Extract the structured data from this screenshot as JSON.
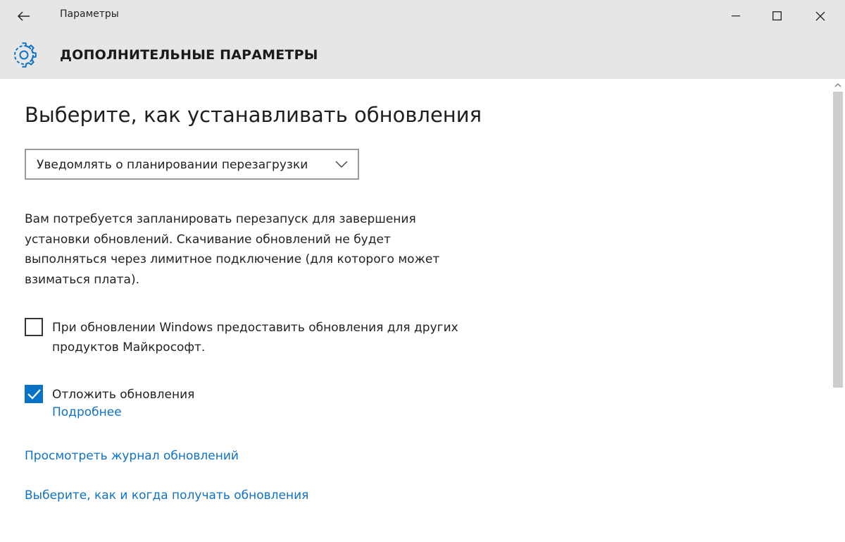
{
  "window": {
    "title": "Параметры",
    "back_icon": "arrow-left-icon",
    "minimize_icon": "minimize-icon",
    "maximize_icon": "maximize-icon",
    "close_icon": "close-icon"
  },
  "header": {
    "icon": "gear-icon",
    "title": "ДОПОЛНИТЕЛЬНЫЕ ПАРАМЕТРЫ"
  },
  "main": {
    "title": "Выберите, как устанавливать обновления",
    "dropdown": {
      "selected": "Уведомлять о планировании перезагрузки",
      "icon": "chevron-down-icon"
    },
    "description": "Вам потребуется запланировать перезапуск для завершения установки обновлений. Скачивание обновлений не будет выполняться через лимитное подключение (для которого может взиматься плата).",
    "checkbox_other_products": {
      "label": "При обновлении Windows предоставить обновления для других продуктов Майкрософт.",
      "checked": false
    },
    "checkbox_defer": {
      "label": "Отложить обновления",
      "checked": true,
      "more_link": "Подробнее"
    },
    "links": {
      "history": "Просмотреть журнал обновлений",
      "delivery": "Выберите, как и когда получать обновления"
    }
  },
  "colors": {
    "chrome_bg": "#e6e6e6",
    "accent": "#0a73c8",
    "link": "#1072c4"
  }
}
